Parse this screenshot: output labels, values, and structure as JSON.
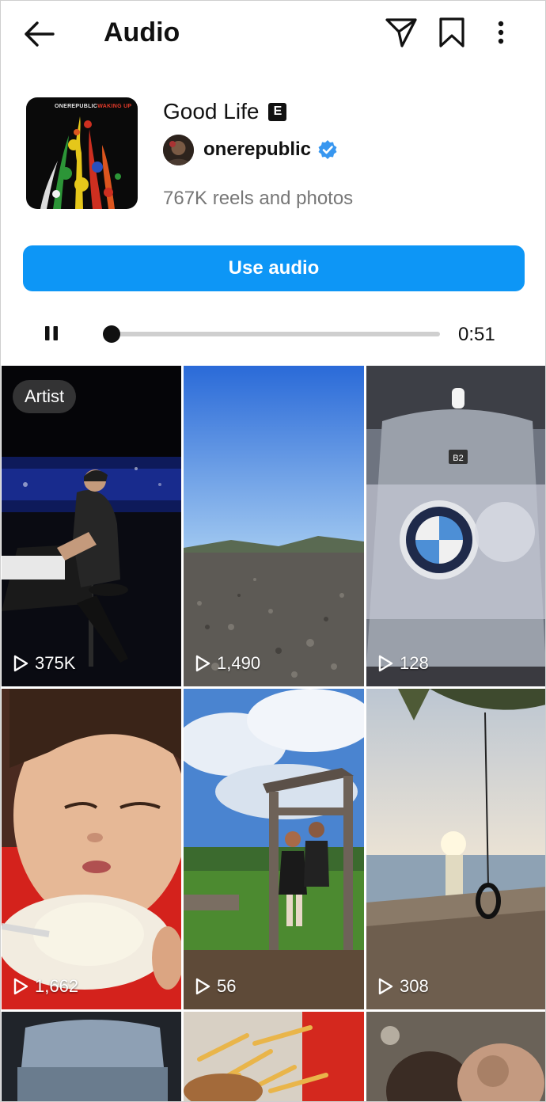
{
  "header": {
    "title": "Audio",
    "icons": [
      "back-arrow-icon",
      "send-icon",
      "bookmark-icon",
      "more-vertical-icon"
    ]
  },
  "audio": {
    "song_title": "Good Life",
    "explicit_badge": "E",
    "artist_name": "onerepublic",
    "verified": true,
    "reels_count": "767K reels and photos",
    "album_cover_text_1": "ONEREPUBLIC",
    "album_cover_text_2": "WAKING UP"
  },
  "actions": {
    "use_audio_label": "Use audio"
  },
  "player": {
    "state": "playing",
    "progress": 0.01,
    "time_label": "0:51"
  },
  "grid": {
    "artist_badge": "Artist",
    "tiles": [
      {
        "views": "375K"
      },
      {
        "views": "1,490"
      },
      {
        "views": "128"
      },
      {
        "views": "1,662"
      },
      {
        "views": "56"
      },
      {
        "views": "308"
      },
      {
        "views": ""
      },
      {
        "views": ""
      },
      {
        "views": ""
      }
    ]
  },
  "colors": {
    "accent": "#0d96f6",
    "verified": "#3897f0"
  }
}
